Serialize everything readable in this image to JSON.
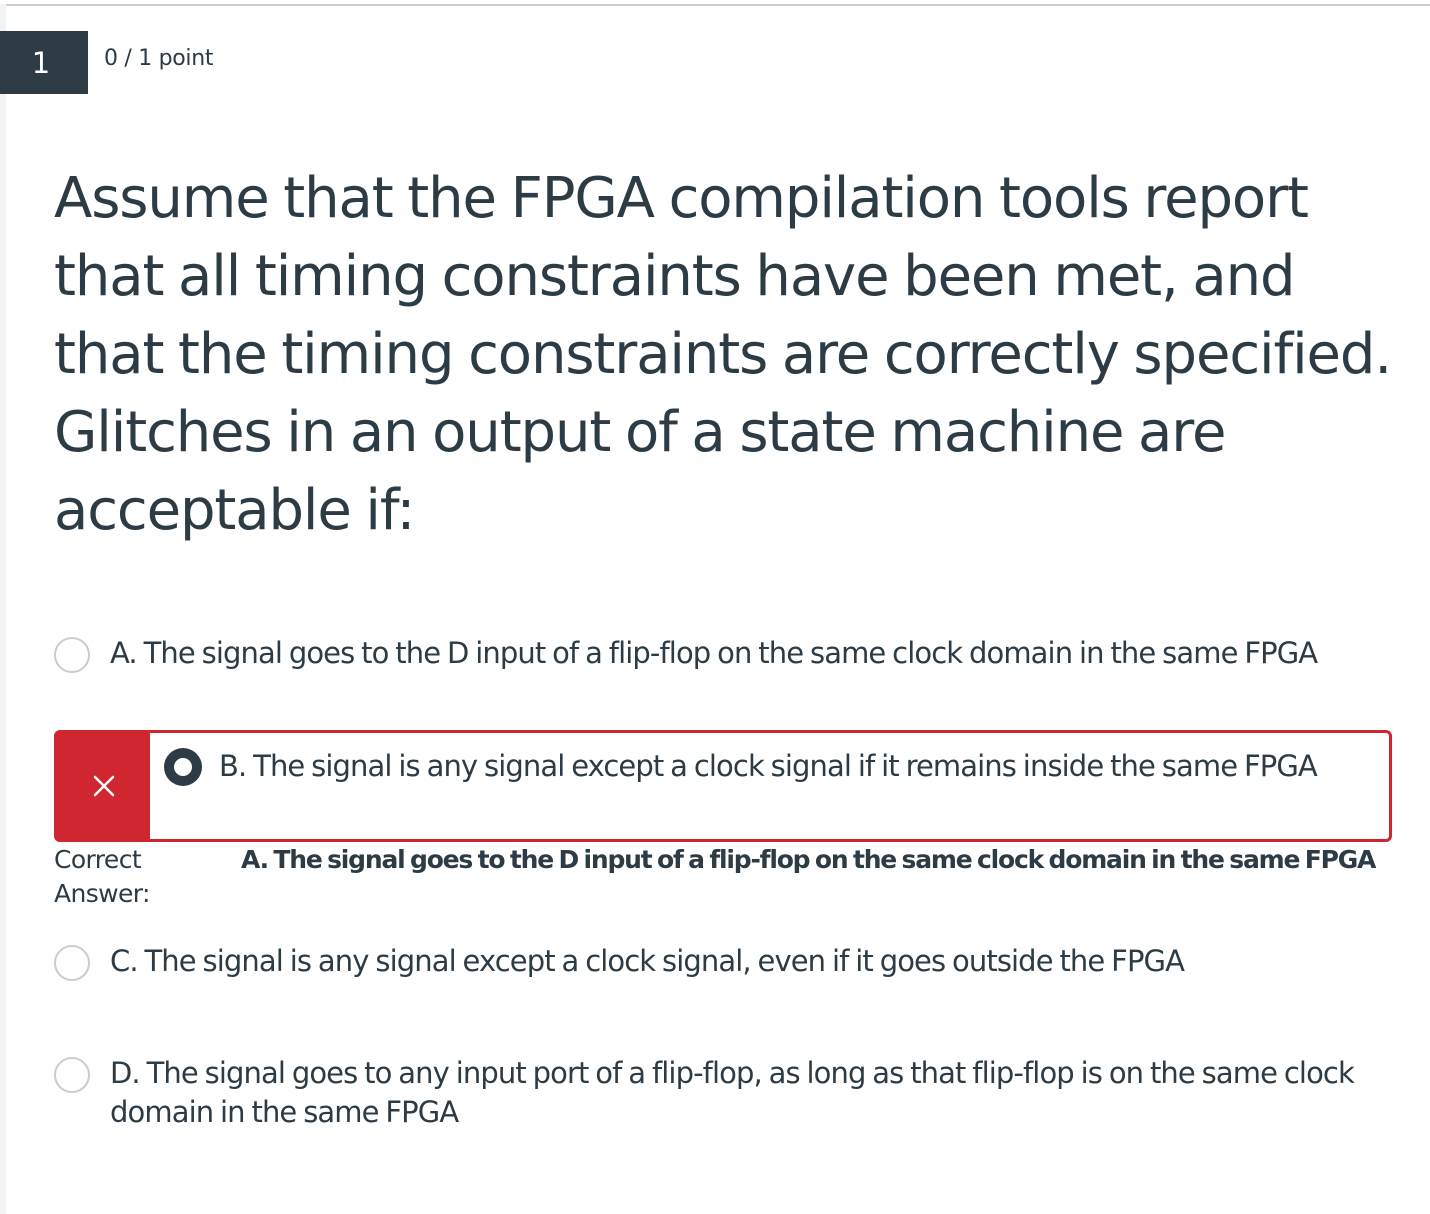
{
  "question": {
    "number": "1",
    "points": "0 / 1 point",
    "text": "Assume that the FPGA compilation tools report that all timing constraints have been met, and that the timing constraints are correctly specified. Glitches in an output of a state machine are acceptable if:"
  },
  "options": {
    "a": "A. The signal goes to the D input of a flip-flop on the same clock domain in the same FPGA",
    "b": "B. The signal is any signal except a clock signal if it remains inside the same FPGA",
    "c": "C. The signal is any signal except a clock signal, even if it goes outside the FPGA",
    "d": "D. The signal goes to any input port of a flip-flop, as long as that flip-flop is on the same clock domain in the same FPGA"
  },
  "selected_option": "b",
  "result": {
    "status_icon": "close-icon",
    "correct_label_line1": "Correct",
    "correct_label_line2": "Answer:",
    "correct_answer": "A. The signal goes to the D input of a flip-flop on the same clock domain in the same FPGA"
  },
  "colors": {
    "text": "#2d3b45",
    "badge_bg": "#2d3b45",
    "incorrect": "#d0262f",
    "radio_border": "#c7cdd1"
  }
}
